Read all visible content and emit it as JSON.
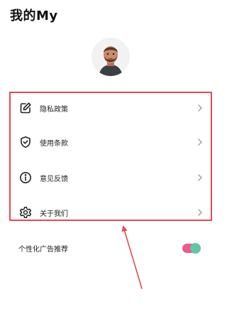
{
  "header": {
    "title": "我的My"
  },
  "profile": {
    "avatar": "avatar-illustration"
  },
  "menu": {
    "items": [
      {
        "label": "隐私政策",
        "icon": "edit-icon"
      },
      {
        "label": "使用条款",
        "icon": "shield-check-icon"
      },
      {
        "label": "意见反馈",
        "icon": "info-icon"
      },
      {
        "label": "关于我们",
        "icon": "settings-icon"
      }
    ]
  },
  "settings": {
    "personalized_ads": {
      "label": "个性化广告推荐",
      "enabled": true
    }
  },
  "colors": {
    "highlight_border": "#e8484f",
    "toggle_track": "#ef5a8a",
    "toggle_knob": "#62c6a4"
  }
}
